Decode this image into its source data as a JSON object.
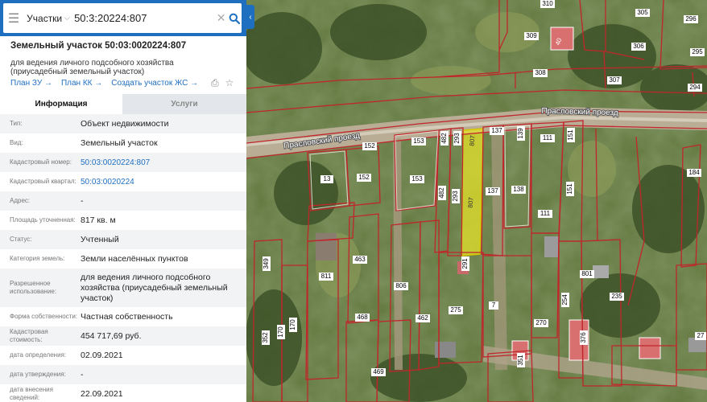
{
  "search": {
    "layer": "Участки",
    "query": "50:3:20224:807"
  },
  "object": {
    "title": "Земельный участок 50:03:0020224:807",
    "description": "для ведения личного подсобного хозяйства (приусадебный земельный участок)"
  },
  "links": {
    "plan_zu": "План ЗУ →",
    "plan_kk": "План КК →",
    "create_zhs": "Создать участок ЖС →"
  },
  "tabs": {
    "info": "Информация",
    "services": "Услуги"
  },
  "rows": [
    {
      "label": "Тип:",
      "value": "Объект недвижимости"
    },
    {
      "label": "Вид:",
      "value": "Земельный участок"
    },
    {
      "label": "Кадастровый номер:",
      "value": "50:03:0020224:807"
    },
    {
      "label": "Кадастровый квартал:",
      "value": "50:03:0020224"
    },
    {
      "label": "Адрес:",
      "value": "-"
    },
    {
      "label": "Площадь уточненная:",
      "value": "817 кв. м"
    },
    {
      "label": "Статус:",
      "value": "Учтенный"
    },
    {
      "label": "Категория земель:",
      "value": "Земли населённых пунктов"
    },
    {
      "label": "Разрешенное использование:",
      "value": "для ведения личного подсобного хозяйства (приусадебный земельный участок)"
    },
    {
      "label": "Форма собственности:",
      "value": "Частная собственность"
    },
    {
      "label": "Кадастровая стоимость:",
      "value": "454 717,69 руб."
    },
    {
      "label": "дата определения:",
      "value": "02.09.2021"
    },
    {
      "label": "дата утверждения:",
      "value": "-"
    },
    {
      "label": "дата внесения сведений:",
      "value": "22.09.2021"
    }
  ],
  "map": {
    "streets": {
      "top": "Праслoвский проезд",
      "left": "Праслoвский проезд"
    },
    "selected_parcel": "807",
    "parcel_labels": [
      "310",
      "305",
      "309",
      "306",
      "295",
      "308",
      "307",
      "294",
      "152",
      "153",
      "482",
      "293",
      "137",
      "139",
      "111",
      "151",
      "13",
      "152",
      "153",
      "482",
      "293",
      "137",
      "138",
      "111",
      "151",
      "184",
      "463",
      "811",
      "806",
      "849",
      "801",
      "235",
      "462",
      "275",
      "7",
      "468",
      "270",
      "254",
      "469",
      "291",
      "351",
      "27",
      "376",
      "352",
      "170",
      "40"
    ]
  }
}
